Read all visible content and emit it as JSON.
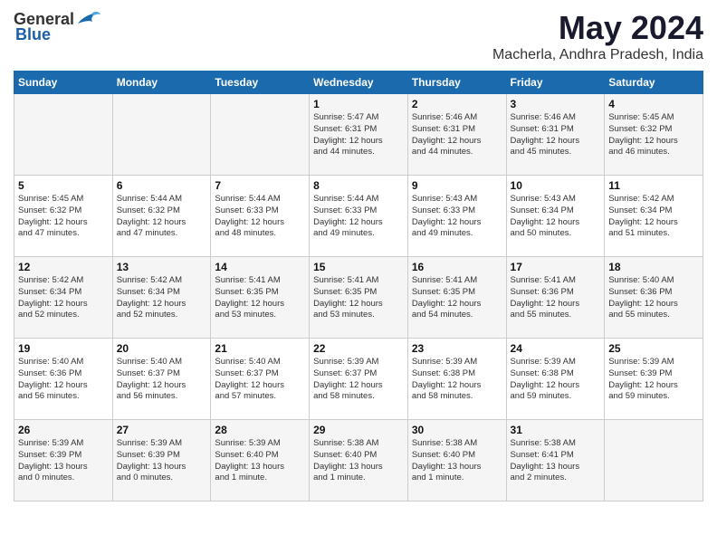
{
  "header": {
    "logo_general": "General",
    "logo_blue": "Blue",
    "month_year": "May 2024",
    "location": "Macherla, Andhra Pradesh, India"
  },
  "days_of_week": [
    "Sunday",
    "Monday",
    "Tuesday",
    "Wednesday",
    "Thursday",
    "Friday",
    "Saturday"
  ],
  "weeks": [
    [
      {
        "day": "",
        "info": ""
      },
      {
        "day": "",
        "info": ""
      },
      {
        "day": "",
        "info": ""
      },
      {
        "day": "1",
        "info": "Sunrise: 5:47 AM\nSunset: 6:31 PM\nDaylight: 12 hours\nand 44 minutes."
      },
      {
        "day": "2",
        "info": "Sunrise: 5:46 AM\nSunset: 6:31 PM\nDaylight: 12 hours\nand 44 minutes."
      },
      {
        "day": "3",
        "info": "Sunrise: 5:46 AM\nSunset: 6:31 PM\nDaylight: 12 hours\nand 45 minutes."
      },
      {
        "day": "4",
        "info": "Sunrise: 5:45 AM\nSunset: 6:32 PM\nDaylight: 12 hours\nand 46 minutes."
      }
    ],
    [
      {
        "day": "5",
        "info": "Sunrise: 5:45 AM\nSunset: 6:32 PM\nDaylight: 12 hours\nand 47 minutes."
      },
      {
        "day": "6",
        "info": "Sunrise: 5:44 AM\nSunset: 6:32 PM\nDaylight: 12 hours\nand 47 minutes."
      },
      {
        "day": "7",
        "info": "Sunrise: 5:44 AM\nSunset: 6:33 PM\nDaylight: 12 hours\nand 48 minutes."
      },
      {
        "day": "8",
        "info": "Sunrise: 5:44 AM\nSunset: 6:33 PM\nDaylight: 12 hours\nand 49 minutes."
      },
      {
        "day": "9",
        "info": "Sunrise: 5:43 AM\nSunset: 6:33 PM\nDaylight: 12 hours\nand 49 minutes."
      },
      {
        "day": "10",
        "info": "Sunrise: 5:43 AM\nSunset: 6:34 PM\nDaylight: 12 hours\nand 50 minutes."
      },
      {
        "day": "11",
        "info": "Sunrise: 5:42 AM\nSunset: 6:34 PM\nDaylight: 12 hours\nand 51 minutes."
      }
    ],
    [
      {
        "day": "12",
        "info": "Sunrise: 5:42 AM\nSunset: 6:34 PM\nDaylight: 12 hours\nand 52 minutes."
      },
      {
        "day": "13",
        "info": "Sunrise: 5:42 AM\nSunset: 6:34 PM\nDaylight: 12 hours\nand 52 minutes."
      },
      {
        "day": "14",
        "info": "Sunrise: 5:41 AM\nSunset: 6:35 PM\nDaylight: 12 hours\nand 53 minutes."
      },
      {
        "day": "15",
        "info": "Sunrise: 5:41 AM\nSunset: 6:35 PM\nDaylight: 12 hours\nand 53 minutes."
      },
      {
        "day": "16",
        "info": "Sunrise: 5:41 AM\nSunset: 6:35 PM\nDaylight: 12 hours\nand 54 minutes."
      },
      {
        "day": "17",
        "info": "Sunrise: 5:41 AM\nSunset: 6:36 PM\nDaylight: 12 hours\nand 55 minutes."
      },
      {
        "day": "18",
        "info": "Sunrise: 5:40 AM\nSunset: 6:36 PM\nDaylight: 12 hours\nand 55 minutes."
      }
    ],
    [
      {
        "day": "19",
        "info": "Sunrise: 5:40 AM\nSunset: 6:36 PM\nDaylight: 12 hours\nand 56 minutes."
      },
      {
        "day": "20",
        "info": "Sunrise: 5:40 AM\nSunset: 6:37 PM\nDaylight: 12 hours\nand 56 minutes."
      },
      {
        "day": "21",
        "info": "Sunrise: 5:40 AM\nSunset: 6:37 PM\nDaylight: 12 hours\nand 57 minutes."
      },
      {
        "day": "22",
        "info": "Sunrise: 5:39 AM\nSunset: 6:37 PM\nDaylight: 12 hours\nand 58 minutes."
      },
      {
        "day": "23",
        "info": "Sunrise: 5:39 AM\nSunset: 6:38 PM\nDaylight: 12 hours\nand 58 minutes."
      },
      {
        "day": "24",
        "info": "Sunrise: 5:39 AM\nSunset: 6:38 PM\nDaylight: 12 hours\nand 59 minutes."
      },
      {
        "day": "25",
        "info": "Sunrise: 5:39 AM\nSunset: 6:39 PM\nDaylight: 12 hours\nand 59 minutes."
      }
    ],
    [
      {
        "day": "26",
        "info": "Sunrise: 5:39 AM\nSunset: 6:39 PM\nDaylight: 13 hours\nand 0 minutes."
      },
      {
        "day": "27",
        "info": "Sunrise: 5:39 AM\nSunset: 6:39 PM\nDaylight: 13 hours\nand 0 minutes."
      },
      {
        "day": "28",
        "info": "Sunrise: 5:39 AM\nSunset: 6:40 PM\nDaylight: 13 hours\nand 1 minute."
      },
      {
        "day": "29",
        "info": "Sunrise: 5:38 AM\nSunset: 6:40 PM\nDaylight: 13 hours\nand 1 minute."
      },
      {
        "day": "30",
        "info": "Sunrise: 5:38 AM\nSunset: 6:40 PM\nDaylight: 13 hours\nand 1 minute."
      },
      {
        "day": "31",
        "info": "Sunrise: 5:38 AM\nSunset: 6:41 PM\nDaylight: 13 hours\nand 2 minutes."
      },
      {
        "day": "",
        "info": ""
      }
    ]
  ]
}
